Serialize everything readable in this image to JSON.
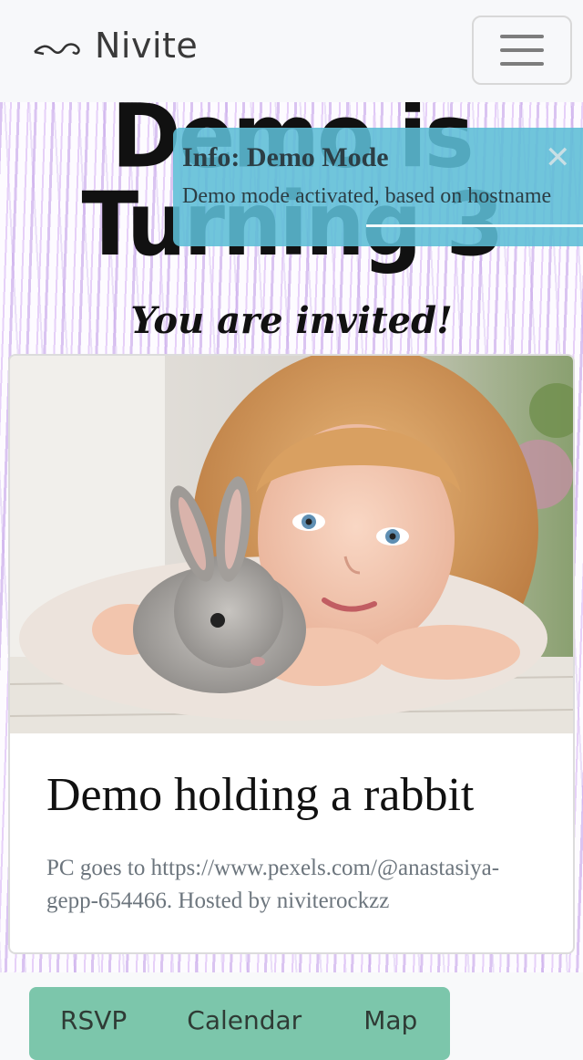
{
  "navbar": {
    "brand": "Nivite",
    "brand_logo_icon": "swirl-logo-icon",
    "menu_icon": "hamburger-menu-icon"
  },
  "hero": {
    "title_line1": "Demo is",
    "title_line2": "Turning 3",
    "subtitle": "You are invited!"
  },
  "toast": {
    "title": "Info: Demo Mode",
    "message": "Demo mode activated, based on hostname",
    "close_icon": "close-icon",
    "color": "#5cbdd6"
  },
  "card": {
    "image_alt": "Girl with a rabbit",
    "title": "Demo holding a rabbit",
    "text": "PC goes to https://www.pexels.com/@anastasiya-gepp-654466. Hosted by niviterockzz"
  },
  "bottom_nav": {
    "color": "#7cc6ab",
    "tabs": [
      "RSVP",
      "Calendar",
      "Map"
    ]
  }
}
